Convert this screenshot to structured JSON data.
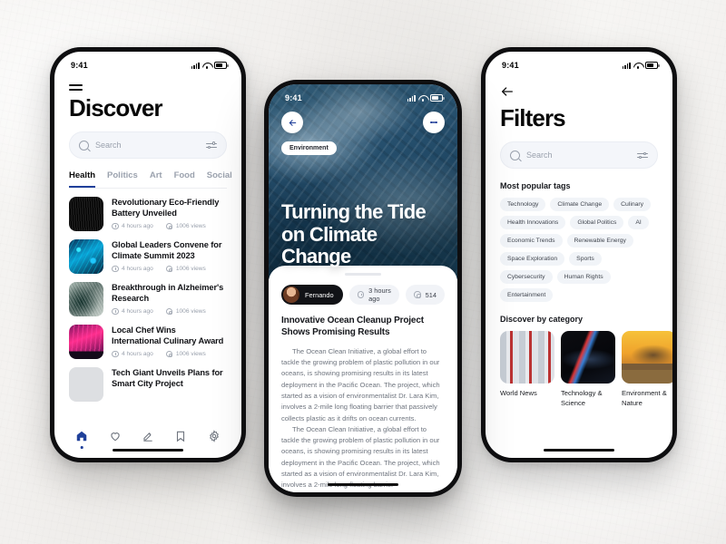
{
  "status_bar": {
    "time": "9:41"
  },
  "phone1": {
    "menu_icon": "hamburger-icon",
    "title": "Discover",
    "search": {
      "placeholder": "Search",
      "icon": "search-icon",
      "filter_icon": "sliders-icon"
    },
    "tabs": [
      {
        "label": "Health",
        "active": true
      },
      {
        "label": "Politics",
        "active": false
      },
      {
        "label": "Art",
        "active": false
      },
      {
        "label": "Food",
        "active": false
      },
      {
        "label": "Social",
        "active": false
      }
    ],
    "news": [
      {
        "title": "Revolutionary Eco-Friendly Battery Unveiled",
        "time": "4 hours ago",
        "views": "1006 views"
      },
      {
        "title": "Global Leaders Convene for Climate Summit 2023",
        "time": "4 hours ago",
        "views": "1006 views"
      },
      {
        "title": "Breakthrough in Alzheimer's Research",
        "time": "4 hours ago",
        "views": "1006 views"
      },
      {
        "title": "Local Chef Wins International Culinary Award",
        "time": "4 hours ago",
        "views": "1006 views"
      },
      {
        "title": "Tech Giant Unveils Plans for Smart City Project",
        "time": "",
        "views": ""
      }
    ],
    "bottom_nav": [
      {
        "icon": "home-icon",
        "active": true
      },
      {
        "icon": "heart-icon",
        "active": false
      },
      {
        "icon": "compose-icon",
        "active": false
      },
      {
        "icon": "bookmark-icon",
        "active": false
      },
      {
        "icon": "gear-icon",
        "active": false
      }
    ],
    "accent_color": "#20409a"
  },
  "phone2": {
    "back_icon": "back-arrow-icon",
    "menu_icon": "kebab-menu-icon",
    "category_tag": "Environment",
    "hero_title": "Turning the Tide on Climate Change",
    "chips": {
      "author": "Fernando",
      "time": "3 hours ago",
      "views": "514",
      "clock_icon": "clock-icon",
      "eye_icon": "eye-icon"
    },
    "article_title": "Innovative Ocean Cleanup Project Shows Promising Results",
    "paragraphs": [
      "The Ocean Clean Initiative, a global effort to tackle the growing problem of plastic pollution in our oceans, is showing promising results in its latest deployment in the Pacific Ocean. The project, which started as a vision of environmentalist Dr. Lara Kim, involves a 2-mile long floating barrier that passively collects plastic as it drifts on ocean currents.",
      "The Ocean Clean Initiative, a global effort to tackle the growing problem of plastic pollution in our oceans, is showing promising results in its latest deployment in the Pacific Ocean. The project, which started as a vision of environmentalist Dr. Lara Kim, involves a 2-mile long floating barrier"
    ]
  },
  "phone3": {
    "back_icon": "back-arrow-icon",
    "title": "Filters",
    "search": {
      "placeholder": "Search",
      "icon": "search-icon",
      "filter_icon": "sliders-icon"
    },
    "tags_heading": "Most popular tags",
    "tags": [
      "Technology",
      "Climate Change",
      "Culinary",
      "Health Innovations",
      "Global Politics",
      "AI",
      "Economic Trends",
      "Renewable Energy",
      "Space Exploration",
      "Sports",
      "Cybersecurity",
      "Human Rights",
      "Entertainment"
    ],
    "category_heading": "Discover by category",
    "categories": [
      {
        "label": "World News"
      },
      {
        "label": "Technology & Science"
      },
      {
        "label": "Environment & Nature"
      }
    ]
  }
}
